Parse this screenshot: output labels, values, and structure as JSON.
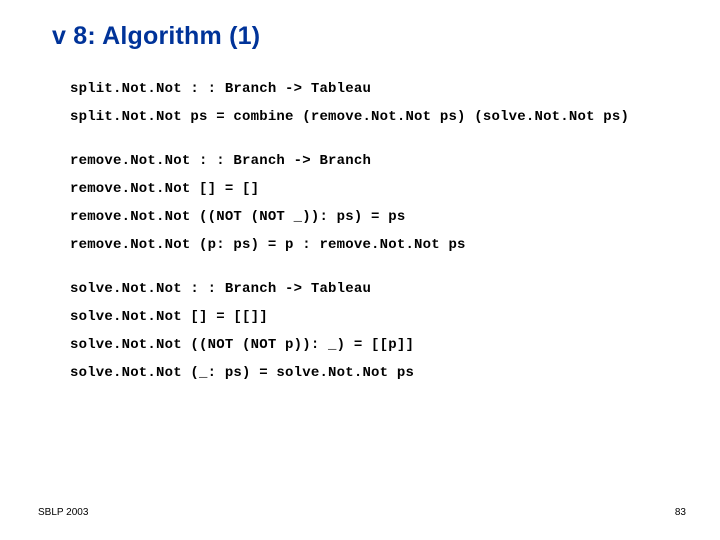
{
  "title": "v 8: Algorithm (1)",
  "blocks": [
    [
      "split.Not.Not : : Branch -> Tableau",
      "split.Not.Not ps = combine (remove.Not.Not ps) (solve.Not.Not ps)"
    ],
    [
      "remove.Not.Not : : Branch -> Branch",
      "remove.Not.Not [] = []",
      "remove.Not.Not ((NOT (NOT _)): ps) = ps",
      "remove.Not.Not (p: ps) = p : remove.Not.Not ps"
    ],
    [
      "solve.Not.Not : : Branch -> Tableau",
      "solve.Not.Not [] = [[]]",
      "solve.Not.Not ((NOT (NOT p)): _) = [[p]]",
      "solve.Not.Not (_: ps) = solve.Not.Not ps"
    ]
  ],
  "footer": {
    "left": "SBLP 2003",
    "right": "83"
  }
}
